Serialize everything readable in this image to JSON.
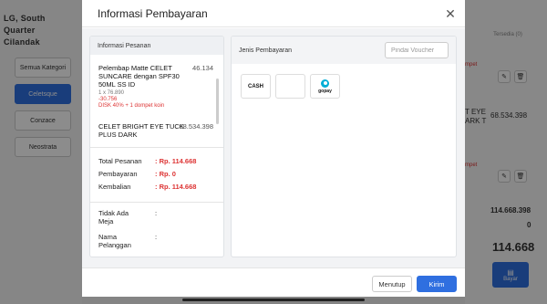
{
  "background": {
    "store_name": "LG, South Quarter Cilandak",
    "categories": [
      "Semua Kategori",
      "Celetsque",
      "Conzace",
      "Neostrata"
    ],
    "active_category": 1,
    "right_col_header": "Tersedia (0)",
    "right_item1_name": "T EYE ARK T",
    "right_item1_price": "68.534.398",
    "right_promo_snippet": "mpet",
    "right_total1": "114.668.398",
    "right_zero": "0",
    "right_big_total": "114.668",
    "pay_button_label": "Bayar"
  },
  "modal": {
    "title": "Informasi Pembayaran",
    "order_panel_title": "Informasi Pesanan",
    "payment_panel_title": "Jenis Pembayaran",
    "voucher_placeholder": "Pindai Voucher",
    "items": [
      {
        "name": "Pelembap Matte CELET SUNCARE dengan SPF30 50ML SS ID",
        "price": "46.134",
        "qty": "1 x 76.890",
        "discount_amount": "-30.756",
        "discount_note": "DISK 40% + 1 dompet koin"
      },
      {
        "name": "CELET BRIGHT EYE TUCK PLUS DARK",
        "price": "68.534.398"
      }
    ],
    "totals": [
      {
        "label": "Total Pesanan",
        "value": ": Rp. 114.668"
      },
      {
        "label": "Pembayaran",
        "value": ": Rp. 0"
      },
      {
        "label": "Kembalian",
        "value": ": Rp. 114.668"
      }
    ],
    "meta": [
      {
        "label": "Tidak Ada Meja",
        "value": ":"
      },
      {
        "label": "Nama Pelanggan",
        "value": ":"
      }
    ],
    "payment_methods": [
      {
        "label": "CASH",
        "icon": "cash-icon"
      },
      {
        "label": "",
        "icon": "blank"
      },
      {
        "label": "gopay",
        "icon": "gopay-icon"
      }
    ],
    "buttons": {
      "close_label": "Menutup",
      "send_label": "Kirim"
    }
  }
}
